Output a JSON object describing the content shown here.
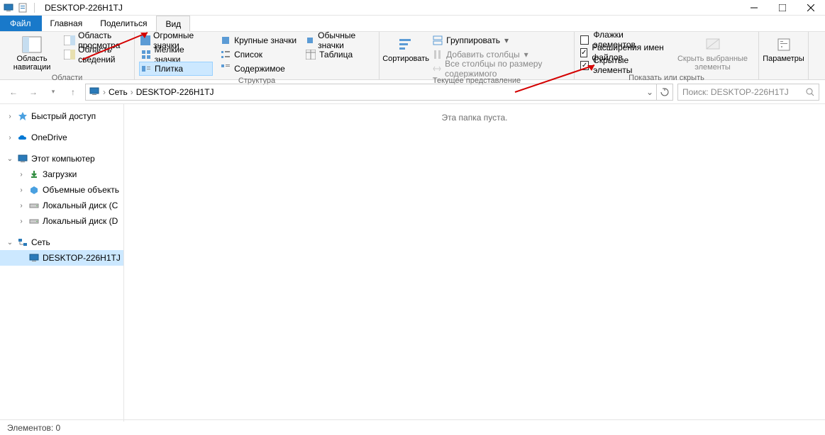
{
  "window": {
    "title": "DESKTOP-226H1TJ"
  },
  "tabs": {
    "file": "Файл",
    "home": "Главная",
    "share": "Поделиться",
    "view": "Вид"
  },
  "ribbon": {
    "panes": {
      "nav_pane": "Область навигации",
      "preview": "Область просмотра",
      "details": "Область сведений",
      "group_label": "Области"
    },
    "layout": {
      "huge": "Огромные значки",
      "large": "Крупные значки",
      "medium": "Обычные значки",
      "small": "Мелкие значки",
      "list": "Список",
      "table": "Таблица",
      "tiles": "Плитка",
      "content": "Содержимое",
      "group_label": "Структура"
    },
    "view": {
      "sort": "Сортировать",
      "group": "Группировать",
      "add_cols": "Добавить столбцы",
      "size_cols": "Все столбцы по размеру содержимого",
      "group_label": "Текущее представление"
    },
    "show": {
      "checkboxes": "Флажки элементов",
      "extensions": "Расширения имен файлов",
      "hidden": "Скрытые элементы",
      "hide_selected": "Скрыть выбранные элементы",
      "group_label": "Показать или скрыть"
    },
    "options": "Параметры"
  },
  "breadcrumb": {
    "net": "Сеть",
    "host": "DESKTOP-226H1TJ"
  },
  "search": {
    "placeholder": "Поиск: DESKTOP-226H1TJ"
  },
  "sidebar": {
    "quick": "Быстрый доступ",
    "onedrive": "OneDrive",
    "this_pc": "Этот компьютер",
    "downloads": "Загрузки",
    "volumes": "Объемные объекть",
    "local_c": "Локальный диск (C",
    "local_d": "Локальный диск (D",
    "network": "Сеть",
    "host": "DESKTOP-226H1TJ"
  },
  "content": {
    "empty": "Эта папка пуста."
  },
  "status": {
    "items": "Элементов: 0"
  }
}
